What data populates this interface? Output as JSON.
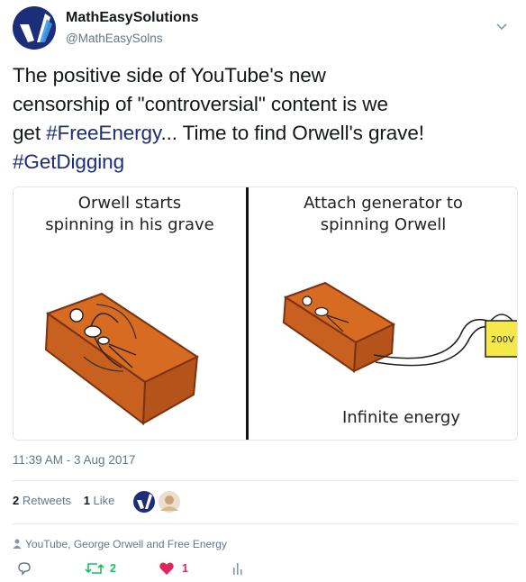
{
  "author": {
    "display_name": "MathEasySolutions",
    "handle": "@MathEasySolns",
    "avatar_icon": "matheasy-logo-icon"
  },
  "menu_icon": "chevron-down-icon",
  "tweet": {
    "text_line1": "The positive side of YouTube's new",
    "text_line2": "censorship of \"controversial\" content is we",
    "text_line3_pre": "get ",
    "hashtag1": "#FreeEnergy",
    "text_line3_post": "... Time to find Orwell's grave!",
    "hashtag2": "#GetDigging"
  },
  "comic": {
    "left_caption_line1": "Orwell starts",
    "left_caption_line2": "spinning in his grave",
    "right_caption_line1": "Attach generator to",
    "right_caption_line2": "spinning Orwell",
    "bottom_caption": "Infinite energy",
    "generator_label": "200V"
  },
  "timestamp": "11:39 AM - 3 Aug 2017",
  "stats": {
    "retweets_count": "2",
    "retweets_label": "Retweets",
    "likes_count": "1",
    "likes_label": "Like"
  },
  "context_line": "YouTube, George Orwell and Free Energy",
  "actions": {
    "reply_icon": "reply-icon",
    "retweet_icon": "retweet-icon",
    "retweet_count": "2",
    "like_icon": "heart-icon",
    "like_count": "1",
    "analytics_icon": "analytics-icon"
  },
  "colors": {
    "brand_navy": "#1c2d7a",
    "brand_blue": "#3b9be5",
    "retweet_green": "#17bf63",
    "like_red": "#e0245e",
    "muted": "#657786",
    "grave_brick": "#c8601f"
  }
}
